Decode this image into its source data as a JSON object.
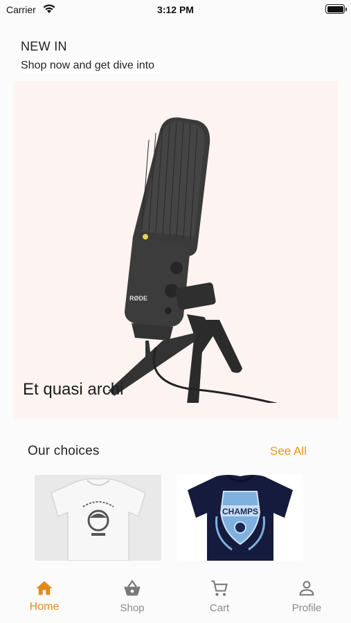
{
  "status_bar": {
    "carrier": "Carrier",
    "time": "3:12 PM"
  },
  "header": {
    "title": "NEW IN",
    "subtitle": "Shop now and get dive into"
  },
  "hero": {
    "caption": "Et quasi archi",
    "image": "microphone-product-image"
  },
  "choices": {
    "title": "Our choices",
    "see_all": "See All",
    "products": [
      {
        "image": "white-tshirt-image"
      },
      {
        "image": "navy-tshirt-image"
      }
    ]
  },
  "tab_bar": {
    "tabs": [
      {
        "label": "Home",
        "icon": "home-icon",
        "active": true
      },
      {
        "label": "Shop",
        "icon": "basket-icon",
        "active": false
      },
      {
        "label": "Cart",
        "icon": "cart-icon",
        "active": false
      },
      {
        "label": "Profile",
        "icon": "profile-icon",
        "active": false
      }
    ]
  },
  "colors": {
    "accent": "#e3891a",
    "hero_bg": "#fdf4f1",
    "inactive": "#8a8a8a"
  }
}
